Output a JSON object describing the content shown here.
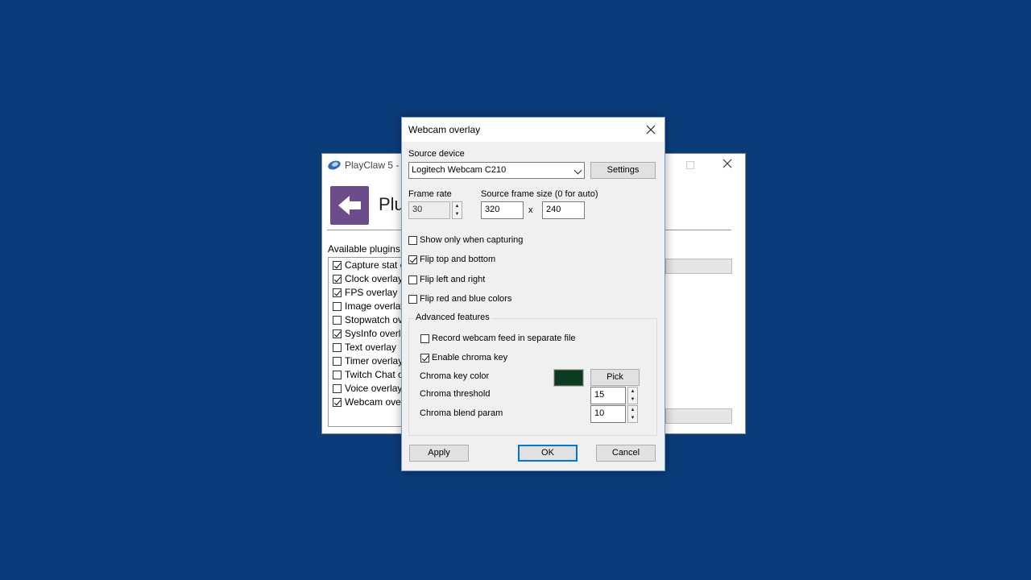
{
  "back_window": {
    "title": "PlayClaw 5 - ",
    "header_title": "Plu",
    "available_plugins_label": "Available plugins",
    "plugins": [
      {
        "label": "Capture stat o",
        "checked": true
      },
      {
        "label": "Clock overlay",
        "checked": true
      },
      {
        "label": "FPS overlay",
        "checked": true
      },
      {
        "label": "Image overlay",
        "checked": false
      },
      {
        "label": "Stopwatch ove",
        "checked": false
      },
      {
        "label": "SysInfo overla",
        "checked": true
      },
      {
        "label": "Text overlay",
        "checked": false
      },
      {
        "label": "Timer overlay",
        "checked": false
      },
      {
        "label": "Twitch Chat ov",
        "checked": false
      },
      {
        "label": "Voice overlay",
        "checked": false
      },
      {
        "label": "Webcam overl",
        "checked": true
      }
    ]
  },
  "dialog": {
    "title": "Webcam overlay",
    "source_device_label": "Source device",
    "source_device_value": "Logitech Webcam C210",
    "settings_button": "Settings",
    "frame_rate_label": "Frame rate",
    "frame_rate_value": "30",
    "frame_size_label": "Source frame size (0 for auto)",
    "frame_width": "320",
    "frame_sep": "x",
    "frame_height": "240",
    "options": [
      {
        "label": "Show only when capturing",
        "checked": false
      },
      {
        "label": "Flip top and bottom",
        "checked": true
      },
      {
        "label": "Flip left and right",
        "checked": false
      },
      {
        "label": "Flip red and blue colors",
        "checked": false
      }
    ],
    "advanced": {
      "label": "Advanced features",
      "record_separate": {
        "label": "Record webcam feed in separate file",
        "checked": false
      },
      "chroma_enable": {
        "label": "Enable chroma key",
        "checked": true
      },
      "chroma_color_label": "Chroma key color",
      "chroma_color": "#0a3d1f",
      "pick_button": "Pick",
      "threshold_label": "Chroma threshold",
      "threshold_value": "15",
      "blend_label": "Chroma blend param",
      "blend_value": "10"
    },
    "apply_button": "Apply",
    "ok_button": "OK",
    "cancel_button": "Cancel"
  }
}
